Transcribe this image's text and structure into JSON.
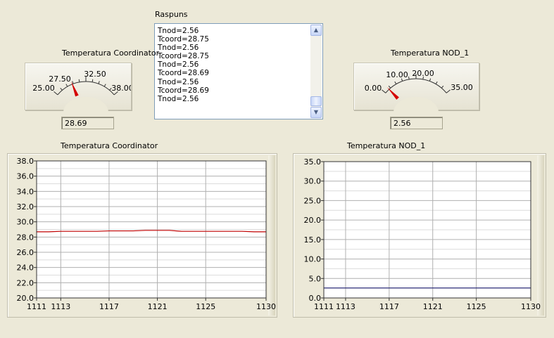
{
  "response_panel": {
    "title": "Raspuns",
    "lines": [
      "Tnod=2.56",
      "Tcoord=28.75",
      "Tnod=2.56",
      "Tcoord=28.75",
      "Tnod=2.56",
      "Tcoord=28.69",
      "Tnod=2.56",
      "Tcoord=28.69",
      "Tnod=2.56"
    ]
  },
  "gauge_coordinator": {
    "title": "Temperatura Coordinator",
    "scale_labels": [
      "25.00",
      "27.50",
      "32.50",
      "38.00"
    ],
    "min": 25.0,
    "max": 38.0,
    "value": 28.69,
    "readout": "28.69",
    "needle_color": "#d40000"
  },
  "gauge_nod1": {
    "title": "Temperatura NOD_1",
    "scale_labels": [
      "0.00",
      "10.00",
      "20.00",
      "35.00"
    ],
    "min": 0.0,
    "max": 35.0,
    "value": 2.56,
    "readout": "2.56",
    "needle_color": "#d40000"
  },
  "chart_data": [
    {
      "type": "line",
      "title": "Temperatura Coordinator",
      "xlabel": "",
      "ylabel": "",
      "x_ticks": [
        "1111",
        "1113",
        "1117",
        "1121",
        "1125",
        "1130"
      ],
      "y_ticks": [
        "20.0",
        "22.0",
        "24.0",
        "26.0",
        "28.0",
        "30.0",
        "32.0",
        "34.0",
        "36.0",
        "38.0"
      ],
      "xlim": [
        1111,
        1130
      ],
      "ylim": [
        20.0,
        38.0
      ],
      "grid": true,
      "series": [
        {
          "color": "#c00000",
          "x": [
            1111,
            1112,
            1113,
            1114,
            1115,
            1116,
            1117,
            1118,
            1119,
            1120,
            1121,
            1122,
            1123,
            1124,
            1125,
            1126,
            1127,
            1128,
            1129,
            1130
          ],
          "y": [
            28.69,
            28.69,
            28.75,
            28.75,
            28.75,
            28.75,
            28.81,
            28.81,
            28.81,
            28.88,
            28.88,
            28.88,
            28.75,
            28.75,
            28.75,
            28.75,
            28.75,
            28.75,
            28.69,
            28.69
          ]
        }
      ]
    },
    {
      "type": "line",
      "title": "Temperatura NOD_1",
      "xlabel": "",
      "ylabel": "",
      "x_ticks": [
        "1111",
        "1113",
        "1117",
        "1121",
        "1125",
        "1130"
      ],
      "y_ticks": [
        "0.0",
        "5.0",
        "10.0",
        "15.0",
        "20.0",
        "25.0",
        "30.0",
        "35.0"
      ],
      "xlim": [
        1111,
        1130
      ],
      "ylim": [
        0.0,
        35.0
      ],
      "grid": true,
      "series": [
        {
          "color": "#1a1a6e",
          "x": [
            1111,
            1130
          ],
          "y": [
            2.56,
            2.56
          ]
        }
      ]
    }
  ]
}
